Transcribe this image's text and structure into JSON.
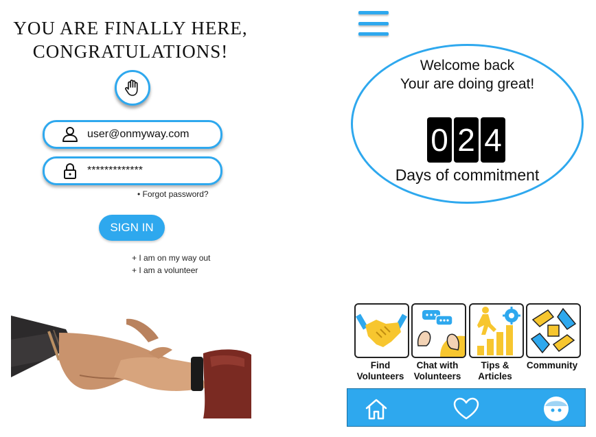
{
  "login": {
    "headline_line1": "YOU ARE FINALLY HERE,",
    "headline_line2": "CONGRATULATIONS!",
    "email_value": "user@onmyway.com",
    "password_value": "*************",
    "forgot_label": "Forgot password?",
    "signin_label": "SIGN IN",
    "options": [
      "+ I am on my way out",
      "+ I am a volunteer"
    ]
  },
  "home": {
    "welcome_line1": "Welcome back",
    "welcome_line2": "Your are doing great!",
    "counter_digits": [
      "0",
      "2",
      "4"
    ],
    "counter_caption": "Days of commitment",
    "tiles": [
      {
        "label": "Find Volunteers",
        "icon": "handshake-icon"
      },
      {
        "label": "Chat with Volunteers",
        "icon": "chat-icon"
      },
      {
        "label": "Tips & Articles",
        "icon": "growth-icon"
      },
      {
        "label": "Community",
        "icon": "community-icon"
      }
    ],
    "nav": [
      "home-icon",
      "heart-icon",
      "profile-icon"
    ]
  },
  "colors": {
    "accent": "#2ea8ee",
    "yellow": "#f7c62f",
    "black": "#000000"
  }
}
